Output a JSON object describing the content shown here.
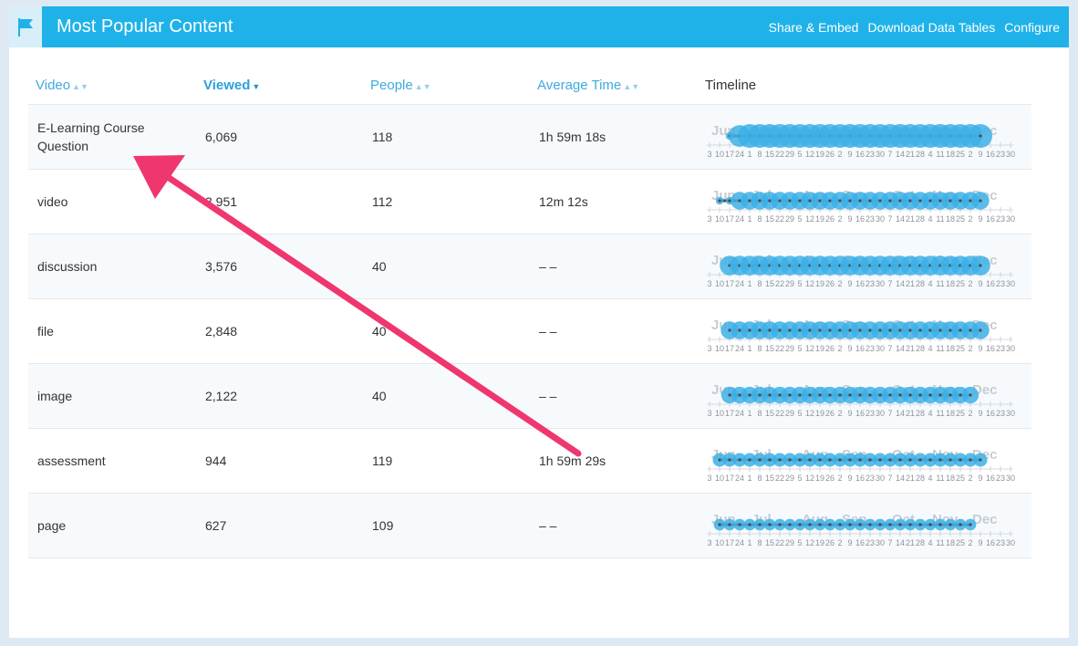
{
  "header": {
    "title": "Most Popular Content",
    "links": [
      "Share & Embed",
      "Download Data Tables",
      "Configure"
    ]
  },
  "table": {
    "columns": {
      "video": "Video",
      "viewed": "Viewed",
      "people": "People",
      "avg_time": "Average Time",
      "timeline": "Timeline"
    },
    "sort": {
      "column": "viewed",
      "direction": "descending"
    },
    "rows": [
      {
        "name": "E-Learning Course Question",
        "viewed": "6,069",
        "people": "118",
        "avg_time": "1h 59m 18s"
      },
      {
        "name": "video",
        "viewed": "3,951",
        "people": "112",
        "avg_time": "12m 12s"
      },
      {
        "name": "discussion",
        "viewed": "3,576",
        "people": "40",
        "avg_time": "– –"
      },
      {
        "name": "file",
        "viewed": "2,848",
        "people": "40",
        "avg_time": "– –"
      },
      {
        "name": "image",
        "viewed": "2,122",
        "people": "40",
        "avg_time": "– –"
      },
      {
        "name": "assessment",
        "viewed": "944",
        "people": "119",
        "avg_time": "1h 59m 29s"
      },
      {
        "name": "page",
        "viewed": "627",
        "people": "109",
        "avg_time": "– –"
      }
    ]
  },
  "timeline": {
    "months": [
      "Jun",
      "Jul",
      "Aug",
      "Sep",
      "Oct",
      "Nov",
      "Dec"
    ],
    "day_ticks": [
      "3",
      "10",
      "17",
      "24",
      "1",
      "8",
      "15",
      "22",
      "29",
      "5",
      "12",
      "19",
      "26",
      "2",
      "9",
      "16",
      "23",
      "30",
      "7",
      "14",
      "21",
      "28",
      "4",
      "11",
      "18",
      "25",
      "2",
      "9",
      "16",
      "23",
      "30"
    ],
    "weekly_intensity": [
      [
        0,
        0,
        0.2,
        0.9,
        1,
        1,
        1,
        1,
        1,
        1,
        1,
        1,
        1,
        1,
        1,
        1,
        1,
        1,
        1,
        1,
        1,
        1,
        1,
        1,
        1,
        1,
        1,
        1,
        0,
        0,
        0
      ],
      [
        0,
        0.2,
        0.2,
        0.7,
        0.7,
        0.7,
        0.7,
        0.7,
        0.7,
        0.7,
        0.7,
        0.7,
        0.7,
        0.7,
        0.7,
        0.7,
        0.7,
        0.7,
        0.7,
        0.7,
        0.7,
        0.7,
        0.7,
        0.7,
        0.7,
        0.7,
        0.7,
        0.7,
        0,
        0,
        0
      ],
      [
        0,
        0,
        0.8,
        0.8,
        0.8,
        0.8,
        0.8,
        0.8,
        0.8,
        0.8,
        0.8,
        0.8,
        0.8,
        0.8,
        0.8,
        0.8,
        0.8,
        0.8,
        0.8,
        0.8,
        0.8,
        0.8,
        0.8,
        0.8,
        0.8,
        0.8,
        0.8,
        0.8,
        0,
        0,
        0
      ],
      [
        0,
        0,
        0.7,
        0.7,
        0.7,
        0.7,
        0.7,
        0.7,
        0.7,
        0.7,
        0.7,
        0.7,
        0.7,
        0.7,
        0.7,
        0.7,
        0.7,
        0.7,
        0.7,
        0.7,
        0.7,
        0.7,
        0.7,
        0.7,
        0.7,
        0.7,
        0.7,
        0.7,
        0,
        0,
        0
      ],
      [
        0,
        0,
        0.65,
        0.65,
        0.65,
        0.65,
        0.65,
        0.65,
        0.65,
        0.65,
        0.65,
        0.65,
        0.65,
        0.65,
        0.65,
        0.65,
        0.65,
        0.65,
        0.65,
        0.65,
        0.65,
        0.65,
        0.65,
        0.65,
        0.65,
        0.65,
        0.65,
        0,
        0,
        0,
        0
      ],
      [
        0,
        0.5,
        0.5,
        0.5,
        0.5,
        0.5,
        0.5,
        0.5,
        0.5,
        0.5,
        0.5,
        0.5,
        0.5,
        0.5,
        0.5,
        0.5,
        0.5,
        0.5,
        0.5,
        0.5,
        0.5,
        0.5,
        0.5,
        0.5,
        0.5,
        0.5,
        0.5,
        0.5,
        0,
        0,
        0
      ],
      [
        0,
        0.4,
        0.4,
        0.4,
        0.4,
        0.4,
        0.4,
        0.4,
        0.4,
        0.4,
        0.4,
        0.4,
        0.4,
        0.4,
        0.4,
        0.4,
        0.4,
        0.4,
        0.4,
        0.4,
        0.4,
        0.4,
        0.4,
        0.4,
        0.4,
        0.4,
        0.4,
        0,
        0,
        0,
        0
      ]
    ],
    "bubble_color": "#3db0e6",
    "line_color": "#4a4a4a"
  },
  "colors": {
    "header_bg": "#1fb2e8",
    "link": "#3fa9e0",
    "annotation_arrow": "#f0366f"
  }
}
